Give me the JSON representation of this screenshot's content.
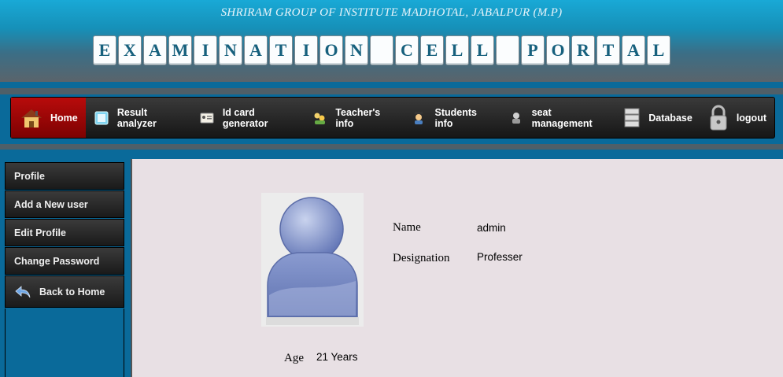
{
  "header": {
    "institute": "SHRIRAM GROUP OF INSTITUTE MADHOTAL, JABALPUR (M.P)",
    "portal_letters": [
      "E",
      "X",
      "A",
      "M",
      "I",
      "N",
      "A",
      "T",
      "I",
      "O",
      "N",
      " ",
      "C",
      "E",
      "L",
      "L",
      " ",
      "P",
      "O",
      "R",
      "T",
      "A",
      "L"
    ]
  },
  "nav": {
    "items": [
      {
        "label": "Home",
        "icon": "house-icon"
      },
      {
        "label": "Result analyzer",
        "icon": "calculator-icon"
      },
      {
        "label": "Id card generator",
        "icon": "id-card-icon"
      },
      {
        "label": "Teacher's info",
        "icon": "teachers-icon"
      },
      {
        "label": "Students info",
        "icon": "student-icon"
      },
      {
        "label": "seat management",
        "icon": "seat-icon"
      },
      {
        "label": "Database",
        "icon": "database-icon"
      },
      {
        "label": "logout",
        "icon": "padlock-icon"
      }
    ]
  },
  "sidebar": {
    "items": [
      {
        "label": "Profile"
      },
      {
        "label": "Add a New user"
      },
      {
        "label": "Edit Profile"
      },
      {
        "label": "Change Password"
      },
      {
        "label": "Back to Home",
        "icon": "back-arrow-icon"
      }
    ]
  },
  "profile": {
    "name_label": "Name",
    "name_value": "admin",
    "designation_label": "Designation",
    "designation_value": "Professer",
    "age_label": "Age",
    "age_value": "21 Years"
  }
}
